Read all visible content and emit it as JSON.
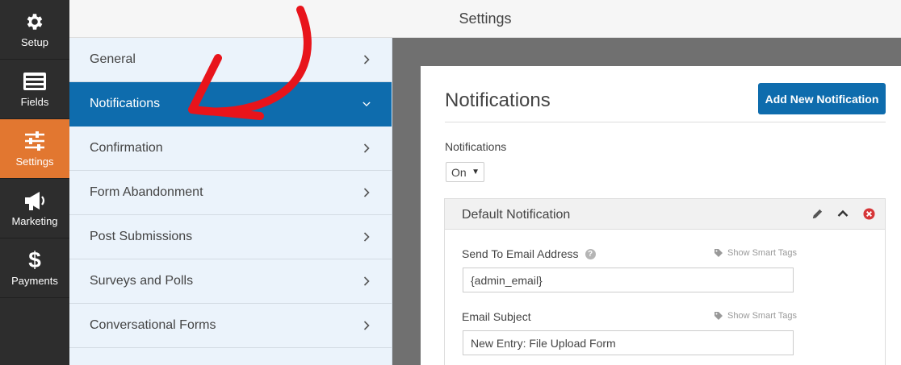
{
  "rail": {
    "items": [
      {
        "label": "Setup",
        "icon": "gear-icon"
      },
      {
        "label": "Fields",
        "icon": "fields-list-icon"
      },
      {
        "label": "Settings",
        "icon": "sliders-icon",
        "active": true
      },
      {
        "label": "Marketing",
        "icon": "megaphone-icon"
      },
      {
        "label": "Payments",
        "icon": "dollar-icon"
      }
    ],
    "active_color": "#e27730"
  },
  "topbar": {
    "title": "Settings"
  },
  "nav": {
    "items": [
      {
        "label": "General"
      },
      {
        "label": "Notifications",
        "active": true
      },
      {
        "label": "Confirmation"
      },
      {
        "label": "Form Abandonment"
      },
      {
        "label": "Post Submissions"
      },
      {
        "label": "Surveys and Polls"
      },
      {
        "label": "Conversational Forms"
      }
    ],
    "active_color": "#0e6cad"
  },
  "panel": {
    "title": "Notifications",
    "add_button": "Add New Notification",
    "notifications_label": "Notifications",
    "notifications_value": "On",
    "box": {
      "title": "Default Notification",
      "send_to_label": "Send To Email Address",
      "send_to_value": "{admin_email}",
      "subject_label": "Email Subject",
      "subject_value": "New Entry: File Upload Form",
      "smart_tags": "Show Smart Tags"
    }
  },
  "annotation_color": "#e8141b"
}
